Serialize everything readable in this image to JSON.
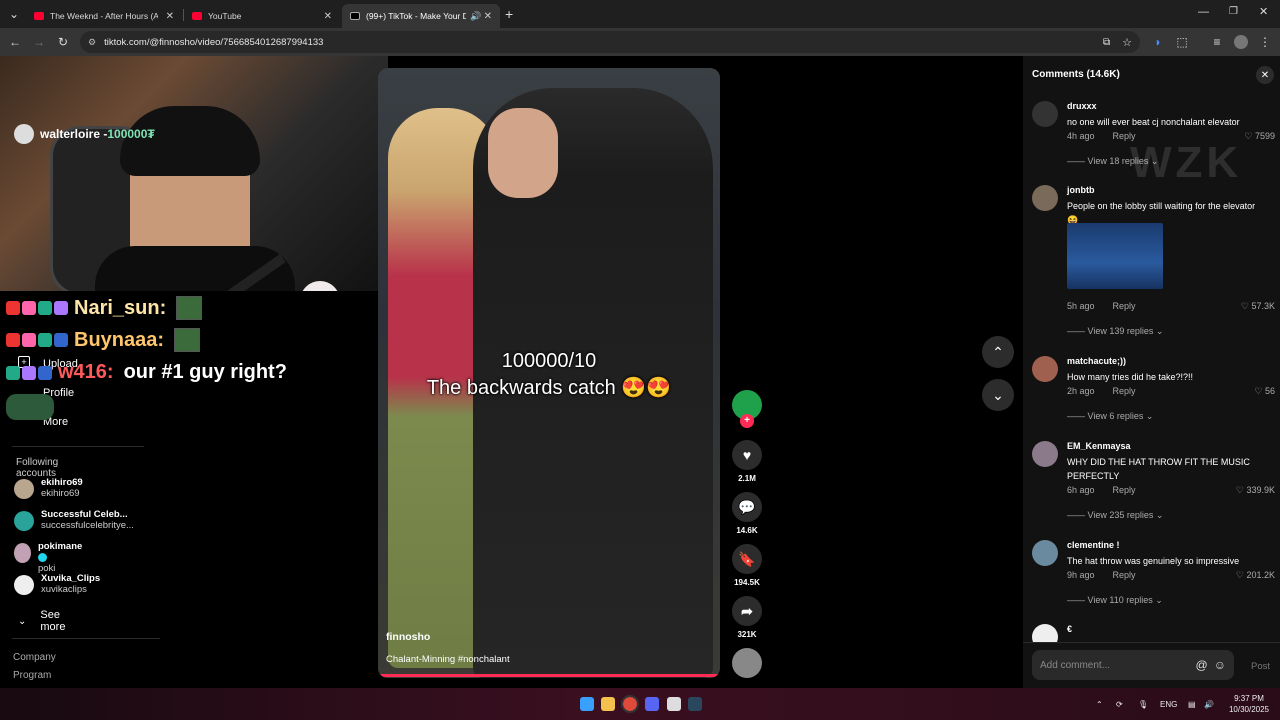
{
  "browser": {
    "tabs": [
      {
        "title": "The Weeknd - After Hours (Aud",
        "active": false
      },
      {
        "title": "YouTube",
        "active": false
      },
      {
        "title": "(99+) TikTok - Make Your Da",
        "active": true
      }
    ],
    "url": "tiktok.com/@finnosho/video/7566854012687994133"
  },
  "stream": {
    "streamer": "walterloire - ",
    "points": "100000₮",
    "chat": [
      {
        "user": "Nari_sun:",
        "message": ""
      },
      {
        "user": "Buynaaa:",
        "message": ""
      },
      {
        "user": "w416:",
        "message": "our #1 guy right?"
      }
    ]
  },
  "sidebar": {
    "menu": [
      "Upload",
      "Profile",
      "More"
    ],
    "following_title": "Following accounts",
    "following": [
      {
        "name": "ekihiro69",
        "handle": "ekihiro69"
      },
      {
        "name": "Successful Celeb...",
        "handle": "successfulcelebritye..."
      },
      {
        "name": "pokimane",
        "handle": "poki"
      },
      {
        "name": "Xuvika_Clips",
        "handle": "xuvikaclips"
      }
    ],
    "see_more": "See more",
    "footer": [
      "Company",
      "Program"
    ]
  },
  "video": {
    "caption_line1": "100000/10",
    "caption_line2": "The backwards catch 😍😍",
    "username": "finnosho",
    "description": "Chalant-Minning #nonchalant"
  },
  "actions": {
    "likes": "2.1M",
    "comments": "14.6K",
    "saves": "194.5K",
    "shares": "321K"
  },
  "comments": {
    "title": "Comments (14.6K)",
    "items": [
      {
        "user": "druxxx",
        "text": "no one will ever beat cj nonchalant elevator",
        "time": "4h ago",
        "likes": "7599",
        "replies": "View 18 replies"
      },
      {
        "user": "jonbtb",
        "text": "People on the lobby still waiting for the elevator 😆",
        "time": "5h ago",
        "likes": "57.3K",
        "replies": "View 139 replies"
      },
      {
        "user": "matchacute;))",
        "text": "How many tries did he take?!?!!",
        "time": "2h ago",
        "likes": "56",
        "replies": "View 6 replies"
      },
      {
        "user": "EM_Kenmaysa",
        "text": "WHY DID THE HAT THROW FIT THE MUSIC PERFECTLY",
        "time": "6h ago",
        "likes": "339.9K",
        "replies": "View 235 replies"
      },
      {
        "user": "clementine !",
        "text": "The hat throw was genuinely so impressive",
        "time": "9h ago",
        "likes": "201.2K",
        "replies": "View 110 replies"
      },
      {
        "user": "€",
        "text": "",
        "time": "",
        "likes": "",
        "replies": ""
      }
    ],
    "reply_label": "Reply",
    "add_placeholder": "Add comment...",
    "post_label": "Post"
  },
  "watermark": "WZK",
  "taskbar": {
    "lang": "ENG",
    "time": "9:37 PM",
    "date": "10/30/2025"
  }
}
